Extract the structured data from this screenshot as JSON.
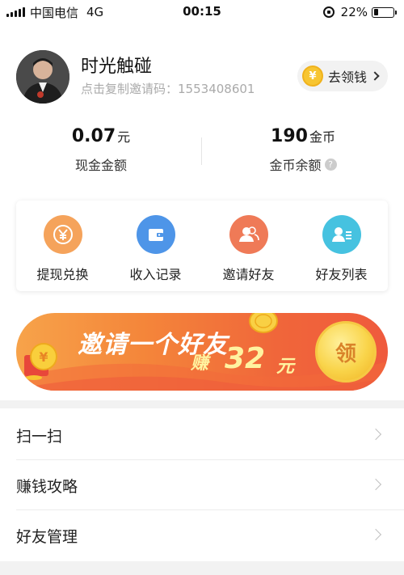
{
  "status_bar": {
    "carrier": "中国电信",
    "network": "4G",
    "time": "00:15",
    "battery": "22%",
    "battery_level": 0.22
  },
  "profile": {
    "username": "时光触碰",
    "invite_prefix": "点击复制邀请码：",
    "invite_code": "1553408601",
    "get_money_label": "去领钱",
    "coin_symbol": "¥"
  },
  "balances": {
    "cash_value": "0.07",
    "cash_unit": "元",
    "cash_label": "现金金额",
    "coin_value": "190",
    "coin_unit": "金币",
    "coin_label": "金币余额",
    "help_symbol": "?"
  },
  "actions": [
    {
      "label": "提现兑换",
      "icon": "yuan-icon",
      "color": "#f5a35b"
    },
    {
      "label": "收入记录",
      "icon": "wallet-icon",
      "color": "#4e95e8"
    },
    {
      "label": "邀请好友",
      "icon": "users-icon",
      "color": "#ef7a57"
    },
    {
      "label": "好友列表",
      "icon": "contact-list-icon",
      "color": "#46c2e0"
    }
  ],
  "banner": {
    "line1": "邀请一个好友",
    "earn": "赚",
    "amount": "32",
    "unit": "元",
    "claim": "领"
  },
  "menu": [
    {
      "label": "扫一扫"
    },
    {
      "label": "赚钱攻略"
    },
    {
      "label": "好友管理"
    }
  ],
  "colors": {
    "accent_yellow": "#f7c531",
    "banner_orange": "#f4853a",
    "divider": "#f2f2f2"
  }
}
